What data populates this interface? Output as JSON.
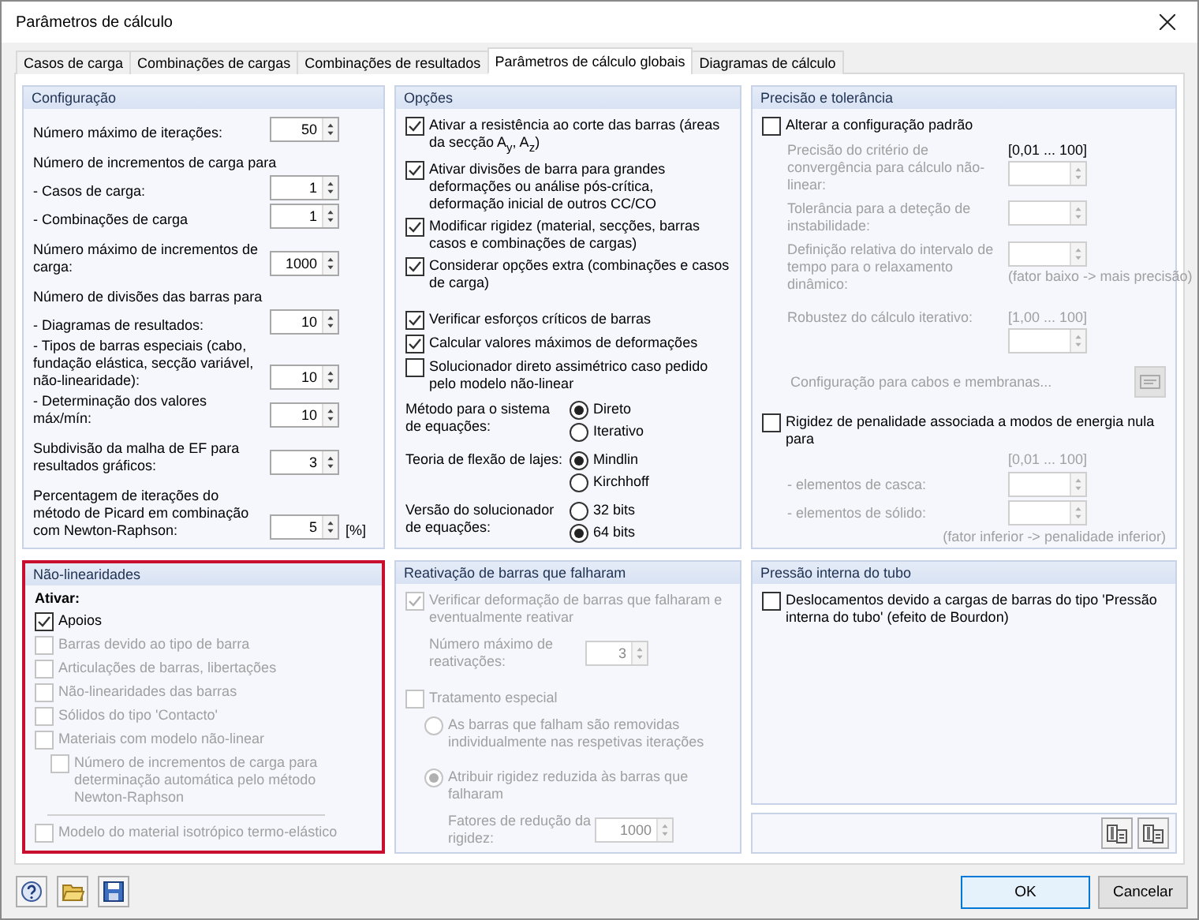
{
  "window": {
    "title": "Parâmetros de cálculo"
  },
  "tabs": [
    {
      "label": "Casos de carga",
      "selected": false
    },
    {
      "label": "Combinações de cargas",
      "selected": false
    },
    {
      "label": "Combinações de resultados",
      "selected": false
    },
    {
      "label": "Parâmetros de cálculo globais",
      "selected": true
    },
    {
      "label": "Diagramas de cálculo",
      "selected": false
    }
  ],
  "configuration": {
    "title": "Configuração",
    "groups": [
      {
        "rows": [
          {
            "label": "Número máximo de iterações:",
            "value": "50"
          }
        ]
      },
      {
        "heading": "Número de incrementos de carga para",
        "rows": [
          {
            "label": "- Casos de carga:",
            "value": "1"
          },
          {
            "label": "- Combinações de carga",
            "value": "1"
          }
        ]
      },
      {
        "rows": [
          {
            "label": "Número máximo de incrementos de carga:",
            "value": "1000"
          }
        ]
      },
      {
        "heading": "Número de divisões das barras para",
        "rows": [
          {
            "label": "- Diagramas de resultados:",
            "value": "10"
          },
          {
            "label": "- Tipos de barras especiais (cabo, fundação elástica, secção variável, não-linearidade):",
            "value": "10"
          },
          {
            "label": "- Determinação dos valores máx/mín:",
            "value": "10"
          }
        ]
      },
      {
        "rows": [
          {
            "label": "Subdivisão da malha de EF para resultados gráficos:",
            "value": "3"
          }
        ]
      },
      {
        "rows": [
          {
            "label": "Percentagem de iterações do método de Picard em combinação com Newton-Raphson:",
            "value": "5",
            "unit": "[%]"
          }
        ]
      }
    ]
  },
  "options": {
    "title": "Opções",
    "check_groups": [
      [
        {
          "label": "Ativar a resistência ao corte das barras (áreas da secção A$_{y}$, A$_{z}$)",
          "checked": true
        },
        {
          "label": "Ativar divisões de barra para grandes deformações ou análise pós-crítica, deformação inicial de outros CC/CO",
          "checked": true
        },
        {
          "label": "Modificar rigidez (material, secções, barras casos e combinações de cargas)",
          "checked": true
        },
        {
          "label": "Considerar opções extra (combinações e casos de carga)",
          "checked": true
        }
      ],
      [
        {
          "label": "Verificar esforços críticos de barras",
          "checked": true
        },
        {
          "label": "Calcular valores máximos de deformações",
          "checked": true
        },
        {
          "label": "Solucionador direto assimétrico caso pedido pelo modelo não-linear",
          "checked": false
        }
      ]
    ],
    "radio_groups": [
      {
        "label": "Método para o sistema de equações:",
        "options": [
          {
            "label": "Direto",
            "selected": true
          },
          {
            "label": "Iterativo",
            "selected": false
          }
        ]
      },
      {
        "label": "Teoria de flexão de lajes:",
        "options": [
          {
            "label": "Mindlin",
            "selected": true
          },
          {
            "label": "Kirchhoff",
            "selected": false
          }
        ]
      },
      {
        "label": "Versão do solucionador de equações:",
        "options": [
          {
            "label": "32 bits",
            "selected": false
          },
          {
            "label": "64 bits",
            "selected": true
          }
        ]
      }
    ]
  },
  "precision": {
    "title": "Precisão e tolerância",
    "override": {
      "label": "Alterar a configuração padrão",
      "checked": false
    },
    "fields": [
      {
        "label": "Precisão do critério de convergência para cálculo não-linear:",
        "range": "[0,01 ... 100]"
      },
      {
        "label": "Tolerância para a deteção de instabilidade:"
      },
      {
        "label": "Definição relativa do intervalo de tempo para o relaxamento dinâmico:",
        "note": "(fator baixo -> mais precisão)"
      },
      {
        "label": "Robustez do cálculo iterativo:",
        "range": "[1,00 ... 100]"
      }
    ],
    "cables": {
      "label": "Configuração para cabos e membranas..."
    },
    "penalty": {
      "label": "Rigidez de penalidade associada a modos de energia nula para",
      "checked": false,
      "range": "[0,01 ... 100]",
      "fields": [
        {
          "label": "- elementos de casca:"
        },
        {
          "label": "- elementos de sólido:"
        }
      ],
      "note": "(fator inferior -> penalidade inferior)"
    }
  },
  "nonlinearities": {
    "title": "Não-linearidades",
    "highlighted": true,
    "activate_label": "Ativar:",
    "items": [
      {
        "label": "Apoios",
        "checked": true,
        "disabled": false
      },
      {
        "label": "Barras devido ao tipo de barra",
        "checked": false,
        "disabled": true
      },
      {
        "label": "Articulações de barras, libertações",
        "checked": false,
        "disabled": true
      },
      {
        "label": "Não-linearidades das barras",
        "checked": false,
        "disabled": true
      },
      {
        "label": "Sólidos do tipo 'Contacto'",
        "checked": false,
        "disabled": true
      },
      {
        "label": "Materiais com modelo não-linear",
        "checked": false,
        "disabled": true,
        "children": [
          {
            "label": "Número de incrementos de carga para determinação automática pelo método Newton-Raphson",
            "checked": false,
            "disabled": true
          }
        ]
      }
    ],
    "items_after_rule": [
      {
        "label": "Modelo do material isotrópico termo-elástico",
        "checked": false,
        "disabled": true
      }
    ]
  },
  "reactivation": {
    "title": "Reativação de barras que falharam",
    "verify": {
      "label": "Verificar deformação de barras que falharam e eventualmente reativar",
      "checked": true,
      "disabled": true
    },
    "max_reactivations": {
      "label": "Número máximo de reativações:",
      "value": "3"
    },
    "special": {
      "label": "Tratamento especial",
      "checked": false
    },
    "modes": [
      {
        "label": "As barras que falham são removidas individualmente nas respetivas iterações",
        "selected": false
      },
      {
        "label": "Atribuir rigidez reduzida às barras que falharam",
        "selected": true
      }
    ],
    "reduction": {
      "label": "Fatores de redução da rigidez:",
      "value": "1000"
    }
  },
  "pipe_pressure": {
    "title": "Pressão interna do tubo",
    "bourdon": {
      "label": "Deslocamentos devido a cargas de barras do tipo 'Pressão interna do tubo' (efeito de Bourdon)",
      "checked": false
    }
  },
  "footer": {
    "buttons": [
      {
        "label": "OK",
        "default": true
      },
      {
        "label": "Cancelar",
        "default": false
      }
    ]
  }
}
